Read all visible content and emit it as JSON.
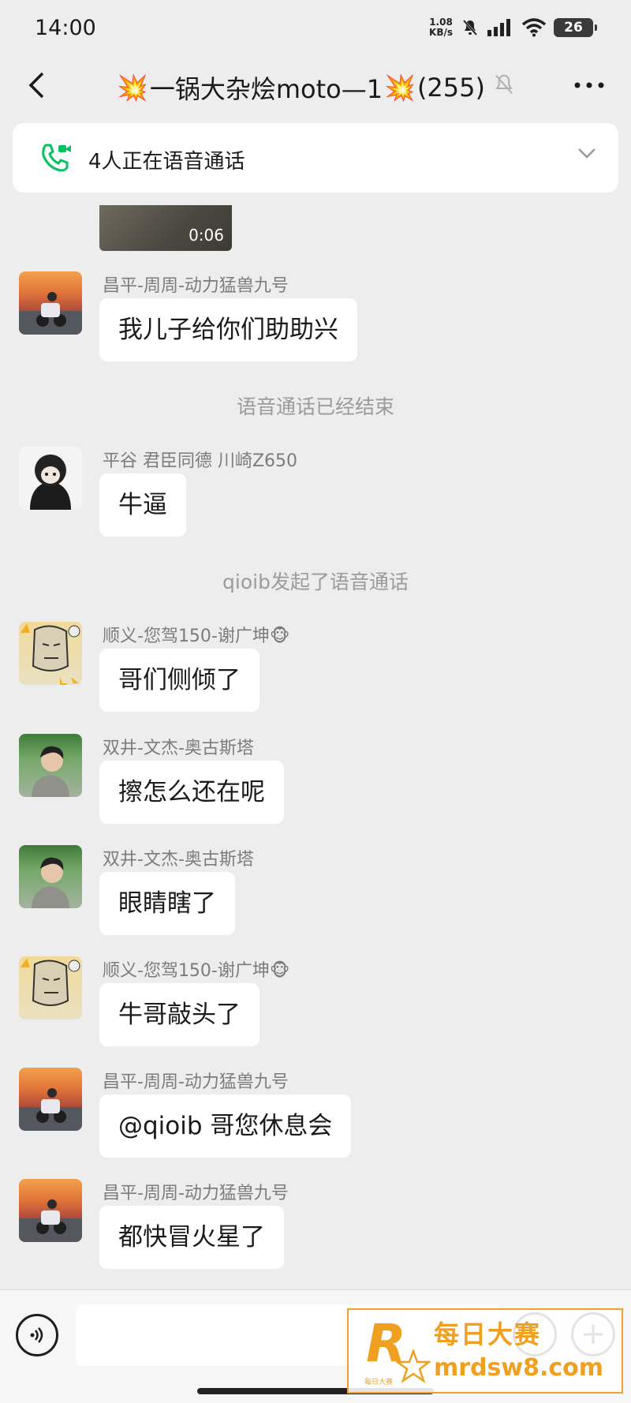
{
  "status_bar": {
    "time": "14:00",
    "net_speed_value": "1.08",
    "net_speed_unit": "KB/s",
    "battery": "26"
  },
  "nav": {
    "title_text": "一锅大杂烩moto—1",
    "member_count": "(255)",
    "title_emoji": "💥"
  },
  "call_banner": {
    "text": "4人正在语音通话"
  },
  "video": {
    "duration": "0:06"
  },
  "messages": [
    {
      "sender": "昌平-周周-动力猛兽九号",
      "text": "我儿子给你们助助兴",
      "avatar": "moto-rider-avatar"
    },
    {
      "sender": "平谷 君臣同德 川崎Z650",
      "text": "牛逼",
      "avatar": "dark-figure-avatar"
    },
    {
      "sender": "顺义-您驾150-谢广坤🐵",
      "text": "哥们侧倾了",
      "avatar": "cartoon-avatar"
    },
    {
      "sender": "双井-文杰-奥古斯塔",
      "text": "擦怎么还在呢",
      "avatar": "boy-avatar"
    },
    {
      "sender": "双井-文杰-奥古斯塔",
      "text": "眼睛瞎了",
      "avatar": "boy-avatar"
    },
    {
      "sender": "顺义-您驾150-谢广坤🐵",
      "text": "牛哥敲头了",
      "avatar": "cartoon-avatar"
    },
    {
      "sender": "昌平-周周-动力猛兽九号",
      "text": "@qioib 哥您休息会",
      "avatar": "moto-rider-avatar"
    },
    {
      "sender": "昌平-周周-动力猛兽九号",
      "text": "都快冒火星了",
      "avatar": "moto-rider-avatar"
    }
  ],
  "system_messages": [
    "语音通话已经结束",
    "qioib发起了语音通话"
  ],
  "watermark": {
    "brand_cn": "每日大赛",
    "url": "mrdsw8.com",
    "small": "每日大赛",
    "logo_letter": "R"
  },
  "colors": {
    "background": "#ededed",
    "bubble": "#ffffff",
    "call_green": "#07c160",
    "watermark": "#f0a020"
  }
}
